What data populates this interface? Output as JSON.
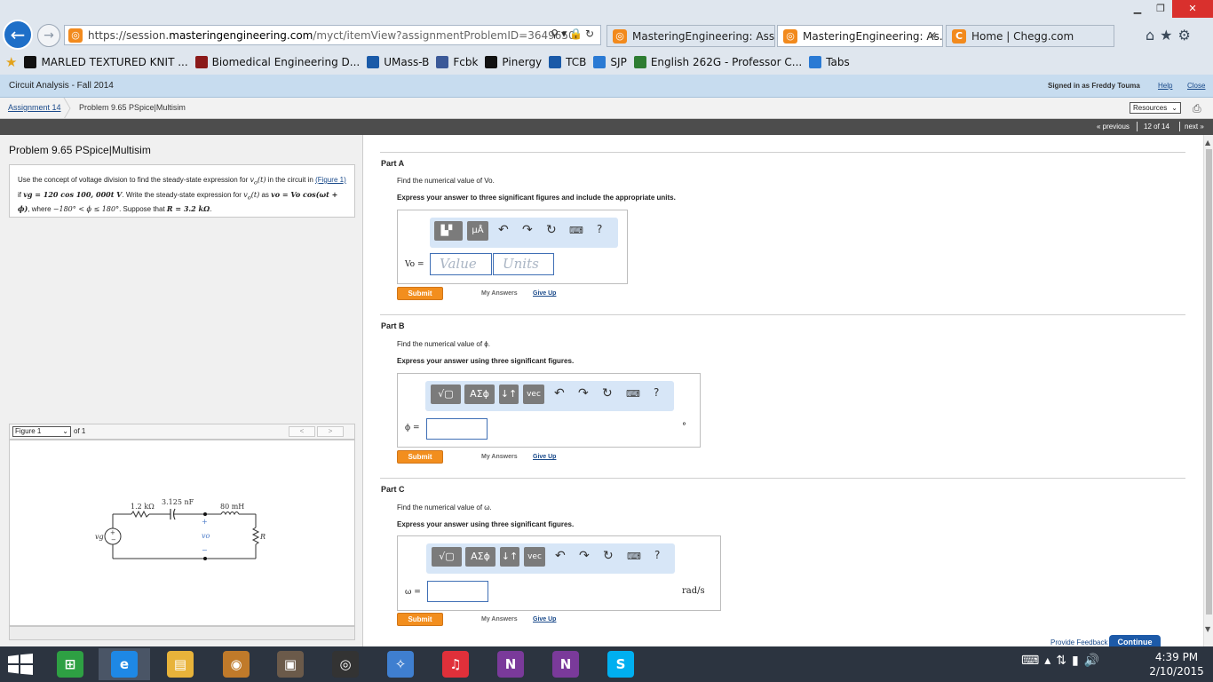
{
  "browser": {
    "url_prefix": "https://session.",
    "url_domain": "masteringengineering.com",
    "url_path": "/myct/itemView?assignmentProblemID=3649650",
    "tabs": [
      {
        "label": "MasteringEngineering: Assig...",
        "active": false
      },
      {
        "label": "MasteringEngineering: As...",
        "active": true
      },
      {
        "label": "Home | Chegg.com",
        "active": false
      }
    ],
    "favorites": [
      {
        "label": "MARLED TEXTURED KNIT ...",
        "icon": "express-icon",
        "color": "#111111"
      },
      {
        "label": "Biomedical Engineering D...",
        "icon": "umass-icon",
        "color": "#8b1a1a"
      },
      {
        "label": "UMass-B",
        "icon": "umass-b-icon",
        "color": "#1a5aa8"
      },
      {
        "label": "Fcbk",
        "icon": "facebook-icon",
        "color": "#3b5998"
      },
      {
        "label": "Pinergy",
        "icon": "pinergy-icon",
        "color": "#111111"
      },
      {
        "label": "TCB",
        "icon": "tcb-icon",
        "color": "#1a5aa8"
      },
      {
        "label": "SJP",
        "icon": "ie-page-icon",
        "color": "#2a7ad4"
      },
      {
        "label": "English 262G - Professor C...",
        "icon": "pinwheel-icon",
        "color": "#2e7d32"
      },
      {
        "label": "Tabs",
        "icon": "ie-page-icon",
        "color": "#2a7ad4"
      }
    ]
  },
  "header": {
    "course": "Circuit Analysis - Fall 2014",
    "signed_in": "Signed in as Freddy Touma",
    "help": "Help",
    "close": "Close",
    "breadcrumb_assignment": "Assignment 14",
    "breadcrumb_problem": "Problem 9.65 PSpice|Multisim",
    "resources": "Resources",
    "previous": "« previous",
    "position": "12 of 14",
    "next": "next »"
  },
  "problem": {
    "title": "Problem 9.65 PSpice|Multisim",
    "text_1": "Use the concept of voltage division to find the steady-state expression for ",
    "vo_t": "v",
    "text_2": " in the circuit in ",
    "figure_link": "(Figure 1)",
    "text_3": " if ",
    "source_expr": "vg = 120 cos 100, 000t V",
    "text_4": ". Write the steady-state expression for ",
    "text_5": " as ",
    "steady_expr": "vo = Vo cos(ωt + ϕ)",
    "text_6": ", where ",
    "range_expr": "−180° < ϕ ≤ 180°",
    "text_7": ". Suppose that ",
    "r_expr": "R = 3.2 kΩ",
    "text_8": "."
  },
  "figure": {
    "selected": "Figure 1",
    "of_text": "of 1",
    "prev": "<",
    "next": ">",
    "labels": {
      "r1": "1.2 kΩ",
      "c": "3.125 nF",
      "l": "80 mH",
      "source": "vg",
      "plus": "+",
      "output": "vo",
      "minus": "−",
      "load": "R"
    }
  },
  "parts": [
    {
      "title": "Part A",
      "instruction": "Find the numerical value of Vo.",
      "instruction_bold": "Express your answer to three significant figures and include the appropriate units.",
      "label": "Vo =",
      "value_placeholder": "Value",
      "units_placeholder": "Units",
      "unit": "",
      "toolbar": [
        "template",
        "µÅ"
      ],
      "submit": "Submit",
      "my_answers": "My Answers",
      "give_up": "Give Up"
    },
    {
      "title": "Part B",
      "instruction": "Find the numerical value of ϕ.",
      "instruction_bold": "Express your answer using three significant figures.",
      "label": "ϕ =",
      "unit": "°",
      "toolbar": [
        "√▢",
        "ΑΣϕ",
        "↓↑",
        "vec"
      ],
      "submit": "Submit",
      "my_answers": "My Answers",
      "give_up": "Give Up"
    },
    {
      "title": "Part C",
      "instruction": "Find the numerical value of ω.",
      "instruction_bold": "Express your answer using three significant figures.",
      "label": "ω =",
      "unit": "rad/s",
      "toolbar": [
        "√▢",
        "ΑΣϕ",
        "↓↑",
        "vec"
      ],
      "submit": "Submit",
      "my_answers": "My Answers",
      "give_up": "Give Up"
    }
  ],
  "footer": {
    "feedback": "Provide Feedback",
    "continue": "Continue"
  },
  "taskbar": {
    "time": "4:39 PM",
    "date": "2/10/2015",
    "apps": [
      {
        "name": "store",
        "glyph": "⊞",
        "color": "#2ea043"
      },
      {
        "name": "internet-explorer",
        "glyph": "e",
        "color": "#1e88e5"
      },
      {
        "name": "file-explorer",
        "glyph": "▤",
        "color": "#e8b33a"
      },
      {
        "name": "app-2",
        "glyph": "◉",
        "color": "#c07a2a"
      },
      {
        "name": "app-3",
        "glyph": "▣",
        "color": "#6b5a4a"
      },
      {
        "name": "app-4",
        "glyph": "◎",
        "color": "#333333"
      },
      {
        "name": "safari",
        "glyph": "✧",
        "color": "#3f7fd0"
      },
      {
        "name": "itunes",
        "glyph": "♫",
        "color": "#e0303a"
      },
      {
        "name": "onenote-1",
        "glyph": "N",
        "color": "#7a3a9a"
      },
      {
        "name": "onenote-2",
        "glyph": "N",
        "color": "#7a3a9a"
      },
      {
        "name": "skype",
        "glyph": "S",
        "color": "#00aff0"
      }
    ]
  }
}
